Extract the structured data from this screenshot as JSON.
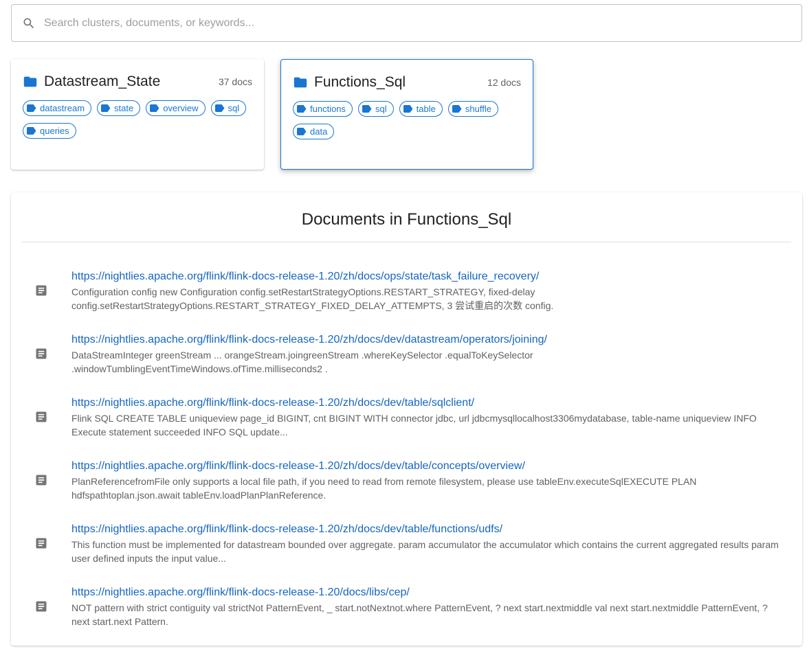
{
  "search": {
    "placeholder": "Search clusters, documents, or keywords...",
    "value": ""
  },
  "clusters": [
    {
      "title": "Datastream_State",
      "count": "37 docs",
      "selected": false,
      "tags": [
        "datastream",
        "state",
        "overview",
        "sql",
        "queries"
      ]
    },
    {
      "title": "Functions_Sql",
      "count": "12 docs",
      "selected": true,
      "tags": [
        "functions",
        "sql",
        "table",
        "shuffle",
        "data"
      ]
    }
  ],
  "documents_panel": {
    "title": "Documents in Functions_Sql",
    "items": [
      {
        "url": "https://nightlies.apache.org/flink/flink-docs-release-1.20/zh/docs/ops/state/task_failure_recovery/",
        "snippet": "Configuration config new Configuration config.setRestartStrategyOptions.RESTART_STRATEGY, fixed-delay config.setRestartStrategyOptions.RESTART_STRATEGY_FIXED_DELAY_ATTEMPTS, 3 尝试重启的次数 config."
      },
      {
        "url": "https://nightlies.apache.org/flink/flink-docs-release-1.20/zh/docs/dev/datastream/operators/joining/",
        "snippet": "DataStreamInteger greenStream ... orangeStream.joingreenStream .whereKeySelector .equalToKeySelector .windowTumblingEventTimeWindows.ofTime.milliseconds2 ."
      },
      {
        "url": "https://nightlies.apache.org/flink/flink-docs-release-1.20/zh/docs/dev/table/sqlclient/",
        "snippet": "Flink SQL CREATE TABLE uniqueview page_id BIGINT, cnt BIGINT WITH connector jdbc, url jdbcmysqllocalhost3306mydatabase, table-name uniqueview INFO Execute statement succeeded INFO SQL update..."
      },
      {
        "url": "https://nightlies.apache.org/flink/flink-docs-release-1.20/zh/docs/dev/table/concepts/overview/",
        "snippet": "PlanReferencefromFile only supports a local file path, if you need to read from remote filesystem, please use tableEnv.executeSqlEXECUTE PLAN hdfspathtoplan.json.await tableEnv.loadPlanPlanReference."
      },
      {
        "url": "https://nightlies.apache.org/flink/flink-docs-release-1.20/zh/docs/dev/table/functions/udfs/",
        "snippet": "This function must be implemented for datastream bounded over aggregate. param accumulator the accumulator which contains the current aggregated results param user defined inputs the input value..."
      },
      {
        "url": "https://nightlies.apache.org/flink/flink-docs-release-1.20/docs/libs/cep/",
        "snippet": "NOT pattern with strict contiguity val strictNot PatternEvent, _ start.notNextnot.where PatternEvent, ? next start.nextmiddle val next start.nextmiddle PatternEvent, ? next start.next Pattern."
      }
    ]
  },
  "colors": {
    "accent": "#1976d2",
    "link": "#1565c0",
    "icon_gray": "#757575"
  },
  "icons": {
    "search": "search-icon",
    "folder": "folder-icon",
    "tag": "tag-icon",
    "document": "document-icon"
  }
}
